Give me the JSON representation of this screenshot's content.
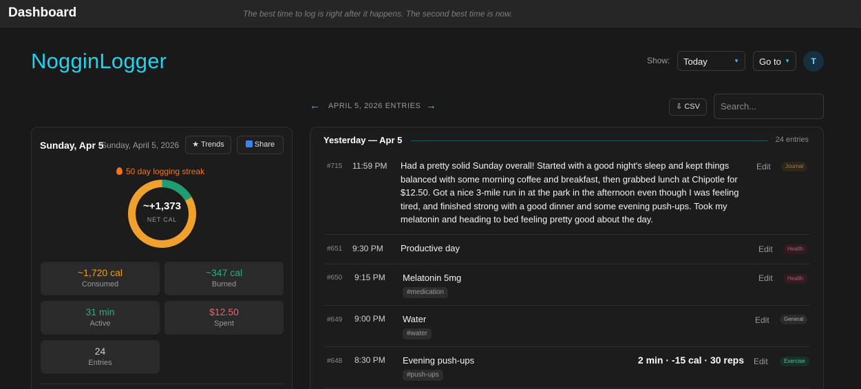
{
  "topbar": {
    "title": "Dashboard",
    "quote": "The best time to log is right after it happens. The second best time is now."
  },
  "brand": "NogginLogger",
  "controls": {
    "show_label": "Show:",
    "show_value": "Today",
    "goto_label": "Go to",
    "avatar_initial": "T"
  },
  "nav": {
    "prev_icon": "←",
    "next_icon": "→",
    "label": "APRIL 5, 2026 ENTRIES",
    "csv_label": "⇩ CSV",
    "search_placeholder": "Search..."
  },
  "summary": {
    "day_title": "Sunday, Apr 5",
    "day_sub": "Sunday, April 5, 2026",
    "trends_label": "★ Trends",
    "share_label": "Share",
    "streak": "50 day logging streak",
    "net_cal_value": "~+1,373",
    "net_cal_label": "NET CAL",
    "donut": {
      "burned_fraction": 0.168,
      "burned_color": "#1f9d72",
      "consumed_color": "#f0a02c"
    },
    "stats": [
      {
        "value": "~1,720 cal",
        "label": "Consumed",
        "color": "#f59e0b"
      },
      {
        "value": "~347 cal",
        "label": "Burned",
        "color": "#2fae82"
      },
      {
        "value": "31 min",
        "label": "Active",
        "color": "#2fae82"
      },
      {
        "value": "$12.50",
        "label": "Spent",
        "color": "#f0606a"
      },
      {
        "value": "24",
        "label": "Entries",
        "color": "#cfcfcf"
      }
    ]
  },
  "entries_panel": {
    "day_heading": "Yesterday — Apr 5",
    "entries_count": "24 entries",
    "edit_label": "Edit",
    "entries": [
      {
        "id": "#715",
        "time": "11:59 PM",
        "text": "Had a pretty solid Sunday overall! Started with a good night's sleep and kept things balanced with some morning coffee and breakfast, then grabbed lunch at Chipotle for $12.50. Got a nice 3-mile run in at the park in the afternoon even though I was feeling tired, and finished strong with a good dinner and some evening push-ups. Took my melatonin and heading to bed feeling pretty good about the day.",
        "category": "Journal"
      },
      {
        "id": "#651",
        "time": "9:30 PM",
        "text": "Productive day",
        "category": "Health"
      },
      {
        "id": "#650",
        "time": "9:15 PM",
        "text": "Melatonin 5mg",
        "tag": "#medication",
        "category": "Health"
      },
      {
        "id": "#649",
        "time": "9:00 PM",
        "text": "Water",
        "tag": "#water",
        "category": "General"
      },
      {
        "id": "#648",
        "time": "8:30 PM",
        "text": "Evening push-ups",
        "tag": "#push-ups",
        "metric": "2 min · -15 cal · 30 reps",
        "category": "Exercise"
      }
    ]
  }
}
